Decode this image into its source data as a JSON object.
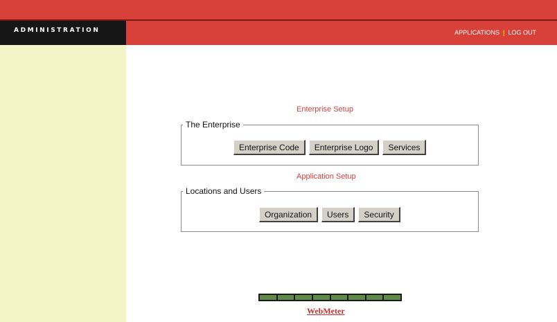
{
  "header": {
    "brand": "ADMINISTRATION",
    "nav": [
      {
        "label": "APPLICATIONS"
      },
      {
        "label": "LOG OUT"
      }
    ],
    "separator": "|",
    "colors": {
      "primary": "#d8403a",
      "brand_bg": "#161616",
      "separator": "#f5d400"
    }
  },
  "sidebar": {
    "color": "#f3f5c8"
  },
  "enterprise_setup": {
    "title": "Enterprise Setup",
    "group_label": "The Enterprise",
    "buttons": [
      {
        "label": "Enterprise Code"
      },
      {
        "label": "Enterprise Logo"
      },
      {
        "label": "Services"
      }
    ]
  },
  "application_setup": {
    "title": "Application Setup",
    "group_label": "Locations and Users",
    "buttons": [
      {
        "label": "Organization"
      },
      {
        "label": "Users"
      },
      {
        "label": "Security"
      }
    ]
  },
  "footer": {
    "meter_label": "WebMeter",
    "meter_segments": 8,
    "meter_color": "#5f8a4a"
  }
}
